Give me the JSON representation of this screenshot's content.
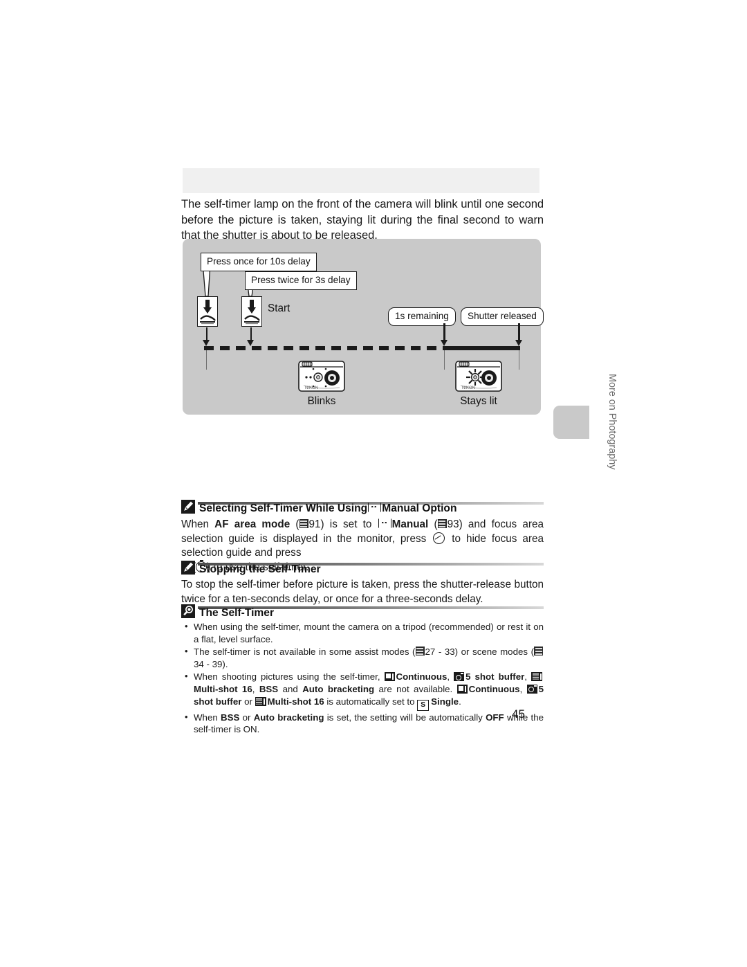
{
  "page": {
    "number": "45",
    "side_tab_label": "More on Photography"
  },
  "intro": {
    "text": "The self-timer lamp on the front of the camera will blink until one second before the picture is taken, staying lit during the final second to warn that the shutter is about to be released."
  },
  "diagram": {
    "callout_once": "Press once for 10s delay",
    "callout_twice": "Press twice for 3s delay",
    "start_label": "Start",
    "pill_remaining": "1s remaining",
    "pill_released": "Shutter released",
    "camera_blinks_caption": "Blinks",
    "camera_lit_caption": "Stays lit",
    "icons": {
      "press_button": "shutter-press-icon",
      "camera_blinking": "camera-lamp-blinking-icon",
      "camera_lit": "camera-lamp-lit-icon"
    }
  },
  "notes": [
    {
      "id": "selecting-self-timer",
      "icon": "pencil-note-icon",
      "title_pre": "Selecting Self-Timer While Using",
      "title_post": "Manual Option",
      "title_icon": "af-manual-icon"
    },
    {
      "id": "stopping-self-timer",
      "icon": "pencil-note-icon",
      "title": "Stopping the Self-Timer",
      "body": "To stop the self-timer before picture is taken, press the shutter-release button twice for a ten-seconds delay, or once for a three-seconds delay."
    },
    {
      "id": "the-self-timer",
      "icon": "magnifier-note-icon",
      "title": "The Self-Timer"
    }
  ],
  "selecting_body": {
    "seg1": "When ",
    "bold1": "AF area mode",
    "seg2": " (",
    "ref1": "91) is set to ",
    "bold2": "Manual",
    "seg3": " (",
    "ref2": "93) and focus area selection guide is displayed in the monitor, press ",
    "seg4": " to hide focus area selection guide and press ",
    "seg5": " (",
    "seg6": ") to use the self-timer."
  },
  "bullets": [
    {
      "text": "When using the self-timer, mount the camera on a tripod (recommended) or rest it on a flat, level surface."
    },
    {
      "pre": "The self-timer is not available in some assist modes (",
      "ref_a": "27 - 33) or scene modes (",
      "ref_b": "34 - 39)."
    },
    {
      "p1": "When shooting pictures using the self-timer, ",
      "b1": "Continuous",
      "p2": ", ",
      "b2": "5 shot buffer",
      "p3": ", ",
      "b3": "Multi-shot 16",
      "p4": ", ",
      "b4": "BSS",
      "p5": " and ",
      "b5": "Auto bracketing",
      "p6": " are not available. ",
      "b6": "Continuous",
      "p7": ", ",
      "b7": "5 shot buffer",
      "p8": " or ",
      "b8": "Multi-shot 16",
      "p9": " is automatically set to ",
      "b9": "Single",
      "p10": "."
    },
    {
      "q1": "When ",
      "qb1": "BSS",
      "q2": " or ",
      "qb2": "Auto bracketing",
      "q3": " is set, the setting will be automatically ",
      "qb3": "OFF",
      "q4": " while the self-timer is ON."
    }
  ],
  "colors": {
    "diagram_bg": "#c9c9c9",
    "band_bg": "#f0f0f0",
    "ink": "#1a1a1a",
    "tab_text": "#6b6b6b"
  }
}
